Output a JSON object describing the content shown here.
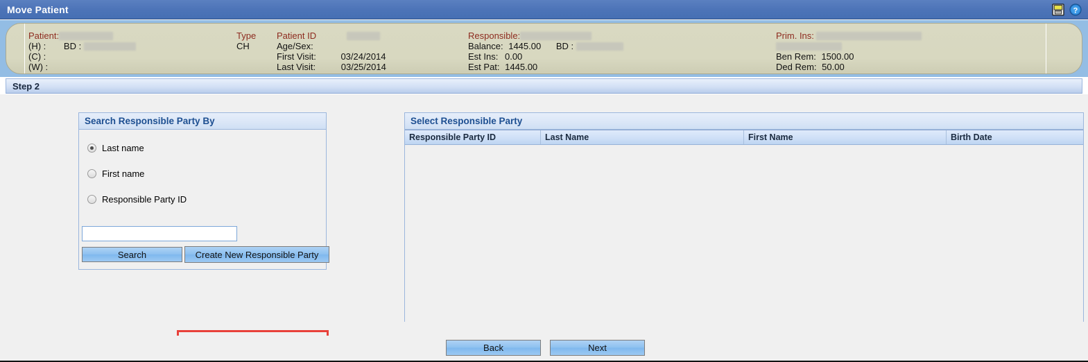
{
  "window": {
    "title": "Move Patient",
    "icons": [
      {
        "name": "save-icon",
        "glyph": "save"
      },
      {
        "name": "help-icon",
        "glyph": "help"
      }
    ]
  },
  "patient_banner": {
    "col1": {
      "patient_label": "Patient:",
      "home_phone_label": "(H) :",
      "bd_label": "BD :",
      "cell_phone_label": "(C) :",
      "work_phone_label": "(W) :"
    },
    "col2": {
      "type_label": "Type",
      "type_value": "CH"
    },
    "col3": {
      "patient_id_label": "Patient ID",
      "age_sex_label": "Age/Sex:",
      "first_visit_label": "First Visit:",
      "first_visit_value": "03/24/2014",
      "last_visit_label": "Last Visit:",
      "last_visit_value": "03/25/2014"
    },
    "col4": {
      "responsible_label": "Responsible:",
      "balance_label": "Balance:",
      "balance_value": "1445.00",
      "bd_label": "BD :",
      "est_ins_label": "Est Ins:",
      "est_ins_value": "0.00",
      "est_pat_label": "Est Pat:",
      "est_pat_value": "1445.00"
    },
    "col5": {
      "prim_ins_label": "Prim. Ins:",
      "ben_rem_label": "Ben Rem:",
      "ben_rem_value": "1500.00",
      "ded_rem_label": "Ded Rem:",
      "ded_rem_value": "50.00"
    }
  },
  "step_bar": {
    "label": "Step 2"
  },
  "search_panel": {
    "title": "Search Responsible Party By",
    "options": [
      {
        "label": "Last name",
        "selected": true
      },
      {
        "label": "First name",
        "selected": false
      },
      {
        "label": "Responsible Party ID",
        "selected": false
      }
    ],
    "input_value": "",
    "input_placeholder": "",
    "search_button": "Search",
    "create_button": "Create New Responsible Party"
  },
  "results_panel": {
    "title": "Select Responsible Party",
    "columns": [
      "Responsible Party ID",
      "Last Name",
      "First Name",
      "Birth Date"
    ],
    "rows": []
  },
  "footer": {
    "back_button": "Back",
    "next_button": "Next"
  },
  "colors": {
    "titlebar": "#4d74b8",
    "banner": "#d8d8c0",
    "panel_border": "#9bb6dd",
    "header_text": "#1d4f91",
    "label_red": "#8d2b1f",
    "button_blue": "#8ec1f0",
    "highlight_red": "#e8413a",
    "body_bg": "#f0f0f0"
  }
}
